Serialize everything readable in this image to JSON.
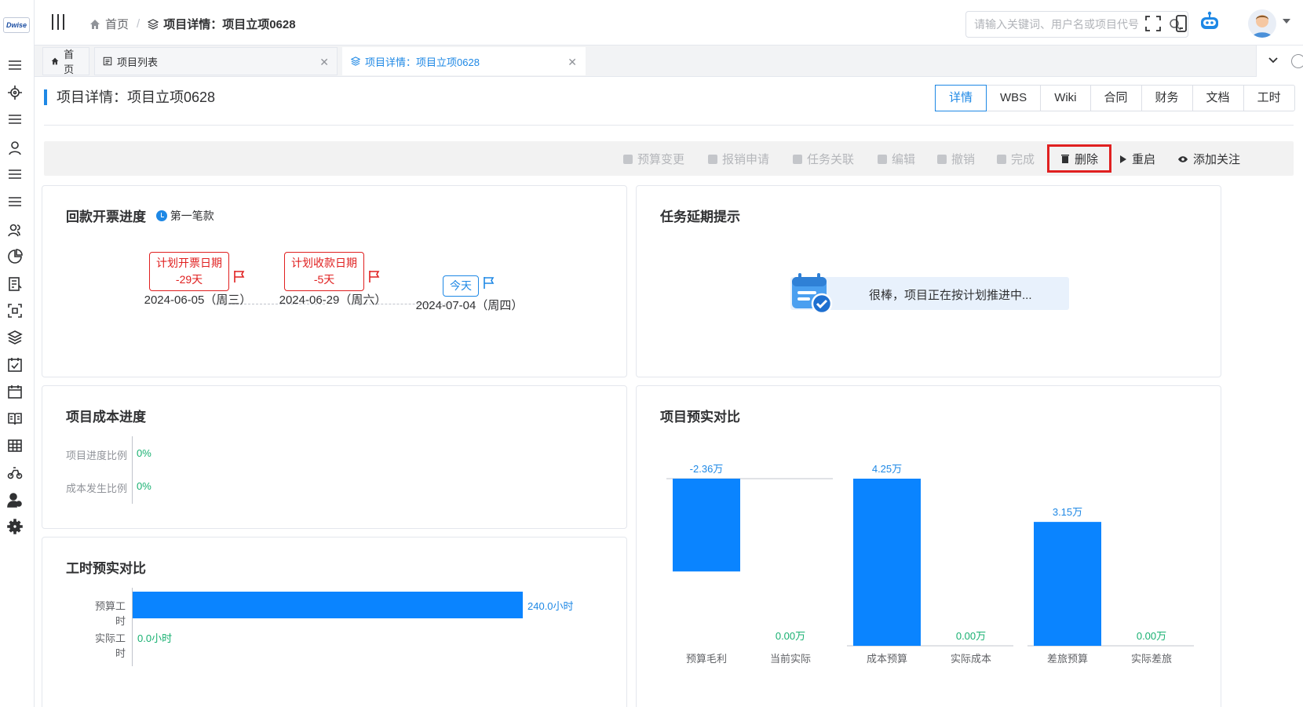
{
  "brand": {
    "logo_text": "Dwise",
    "accent": "#1e88e5",
    "danger": "#e02020",
    "bar": "#0a84ff",
    "positive": "#18b071"
  },
  "header": {
    "breadcrumb_home": "首页",
    "breadcrumb_current": "项目详情：项目立项0628",
    "search_placeholder": "请输入关键词、用户名或项目代号"
  },
  "sidebar": {
    "icons": [
      "menu-icon",
      "locate-icon",
      "list-icon",
      "user-icon",
      "list-icon",
      "list-icon",
      "users-icon",
      "pie-chart-icon",
      "report-icon",
      "scan-icon",
      "layers-icon",
      "checklist-icon",
      "calendar-icon",
      "book-icon",
      "grid-icon",
      "bike-icon",
      "user-settings-icon",
      "gear-icon"
    ]
  },
  "tabs": [
    {
      "label": "首页"
    },
    {
      "label": "项目列表"
    },
    {
      "label": "项目详情：项目立项0628"
    }
  ],
  "page": {
    "title": "项目详情：项目立项0628",
    "view_tabs": [
      "详情",
      "WBS",
      "Wiki",
      "合同",
      "财务",
      "文档",
      "工时"
    ],
    "active_view_tab": "详情"
  },
  "actions": {
    "budget_change": "预算变更",
    "reimburse": "报销申请",
    "task_link": "任务关联",
    "edit": "编辑",
    "revoke": "撤销",
    "complete": "完成",
    "delete": "删除",
    "restart": "重启",
    "follow": "添加关注"
  },
  "payment": {
    "title": "回款开票进度",
    "installment": "第一笔款",
    "milestones": [
      {
        "label": "计划开票日期",
        "delta": "-29天",
        "date": "2024-06-05（周三）",
        "style": "red"
      },
      {
        "label": "计划收款日期",
        "delta": "-5天",
        "date": "2024-06-29（周六）",
        "style": "red"
      },
      {
        "label": "今天",
        "delta": "",
        "date": "2024-07-04（周四）",
        "style": "blue"
      }
    ]
  },
  "delay": {
    "title": "任务延期提示",
    "message": "很棒，项目正在按计划推进中..."
  },
  "cost_progress": {
    "title": "项目成本进度",
    "rows": [
      {
        "label": "项目进度比例",
        "value": "0%"
      },
      {
        "label": "成本发生比例",
        "value": "0%"
      }
    ]
  },
  "hours": {
    "title": "工时预实对比",
    "rows": [
      {
        "label": "预算工时",
        "value": 240.0,
        "text": "240.0小时"
      },
      {
        "label": "实际工时",
        "value": 0.0,
        "text": "0.0小时"
      }
    ],
    "max": 240.0
  },
  "budget_compare": {
    "title": "项目预实对比"
  },
  "chart_data": {
    "type": "bar",
    "title": "项目预实对比",
    "categories": [
      "预算毛利",
      "当前实际",
      "成本预算",
      "实际成本",
      "差旅预算",
      "实际差旅"
    ],
    "values": [
      -2.36,
      0.0,
      4.25,
      0.0,
      3.15,
      0.0
    ],
    "labels": [
      "-2.36万",
      "0.00万",
      "4.25万",
      "0.00万",
      "3.15万",
      "0.00万"
    ],
    "groups": [
      [
        0,
        1
      ],
      [
        2,
        3
      ],
      [
        4,
        5
      ]
    ],
    "unit": "万",
    "bar_color": "#0a84ff"
  }
}
